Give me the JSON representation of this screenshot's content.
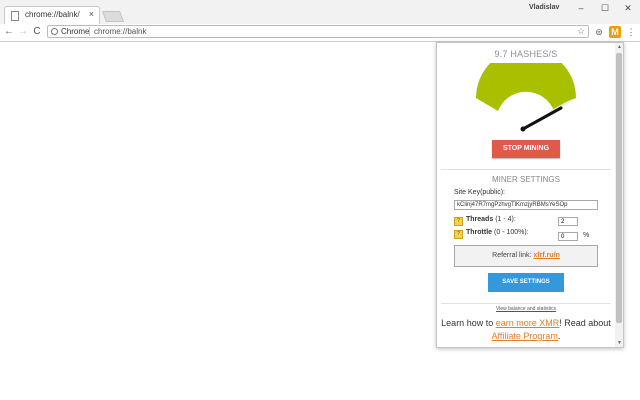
{
  "browser": {
    "tab_title": "chrome://balnk/",
    "tab_close": "×",
    "user_name": "Vladislav",
    "window_buttons": {
      "minimize": "–",
      "maximize": "☐",
      "close": "✕"
    },
    "nav": {
      "back": "←",
      "forward": "→",
      "reload": "C"
    },
    "omnibox": {
      "origin": "Chrome",
      "url": "chrome://balnk"
    },
    "icons": [
      "star-icon",
      "account-icon",
      "miner-extension-icon",
      "menu-icon"
    ],
    "icon_glyphs": {
      "star": "☆",
      "account": "⊜",
      "extension": "M",
      "menu": "⋮"
    }
  },
  "popup": {
    "hashrate": "9.7 HASHES/S",
    "gauge": {
      "level": 0.8,
      "fill_color": "#a8c000",
      "track_color": "#e4e4e4"
    },
    "stop_button": "STOP MINING",
    "settings_title": "MINER SETTINGS",
    "site_key_label": "Site Key(public):",
    "site_key_value": "kClinj47R7mgPzhvgTlKmzjyRBMsYeSOp",
    "threads": {
      "label_bold": "Threads",
      "label_range": "(1 - 4):",
      "value": "2"
    },
    "throttle": {
      "label_bold": "Throttle",
      "label_range": "(0 - 100%):",
      "value": "0",
      "unit": "%"
    },
    "help_glyph": "?",
    "referral": {
      "label": "Referral link:",
      "link": "xfrf.ru/n"
    },
    "save_button": "SAVE SETTINGS",
    "stats_link": "View balance and statistics",
    "learn": {
      "prefix": "Learn how to",
      "earn_link": "earn more XMR",
      "middle": "! Read about",
      "affiliate_link": "Affiliate Program",
      "suffix": "."
    },
    "colors": {
      "stop": "#e05a4c",
      "save": "#3498db",
      "link": "#e67e22"
    }
  }
}
